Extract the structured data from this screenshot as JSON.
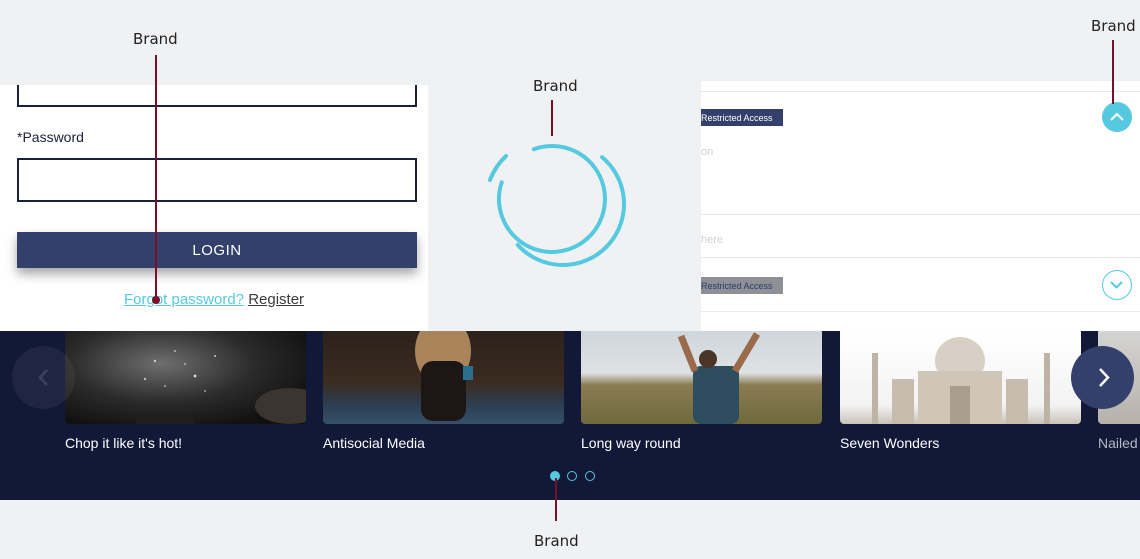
{
  "callouts": {
    "top_left": "Brand",
    "top_right": "Brand",
    "spinner": "Brand",
    "bottom": "Brand"
  },
  "login": {
    "password_label": "*Password",
    "username_value": "",
    "password_value": "",
    "login_label": "LOGIN",
    "forgot_label": "Forgot password?",
    "register_label": "Register"
  },
  "accordion": {
    "items": [
      {
        "badge": "Restricted Access",
        "text": "on",
        "expanded": true
      },
      {
        "badge": "Restricted Access",
        "text": "here",
        "expanded": false
      }
    ]
  },
  "carousel": {
    "cards": [
      {
        "title": "Chop it like it's hot!"
      },
      {
        "title": "Antisocial Media"
      },
      {
        "title": "Long way round"
      },
      {
        "title": "Seven Wonders"
      },
      {
        "title": "Nailed"
      }
    ],
    "page_count": 3,
    "active_page": 1
  },
  "colors": {
    "accent": "#54c9df",
    "brand_navy": "#33406b",
    "carousel_bg": "#111838",
    "leader": "#7a0f2a"
  },
  "icons": {
    "prev": "chevron-left-icon",
    "next": "chevron-right-icon",
    "collapse": "chevron-up-icon",
    "expand": "chevron-down-icon"
  }
}
